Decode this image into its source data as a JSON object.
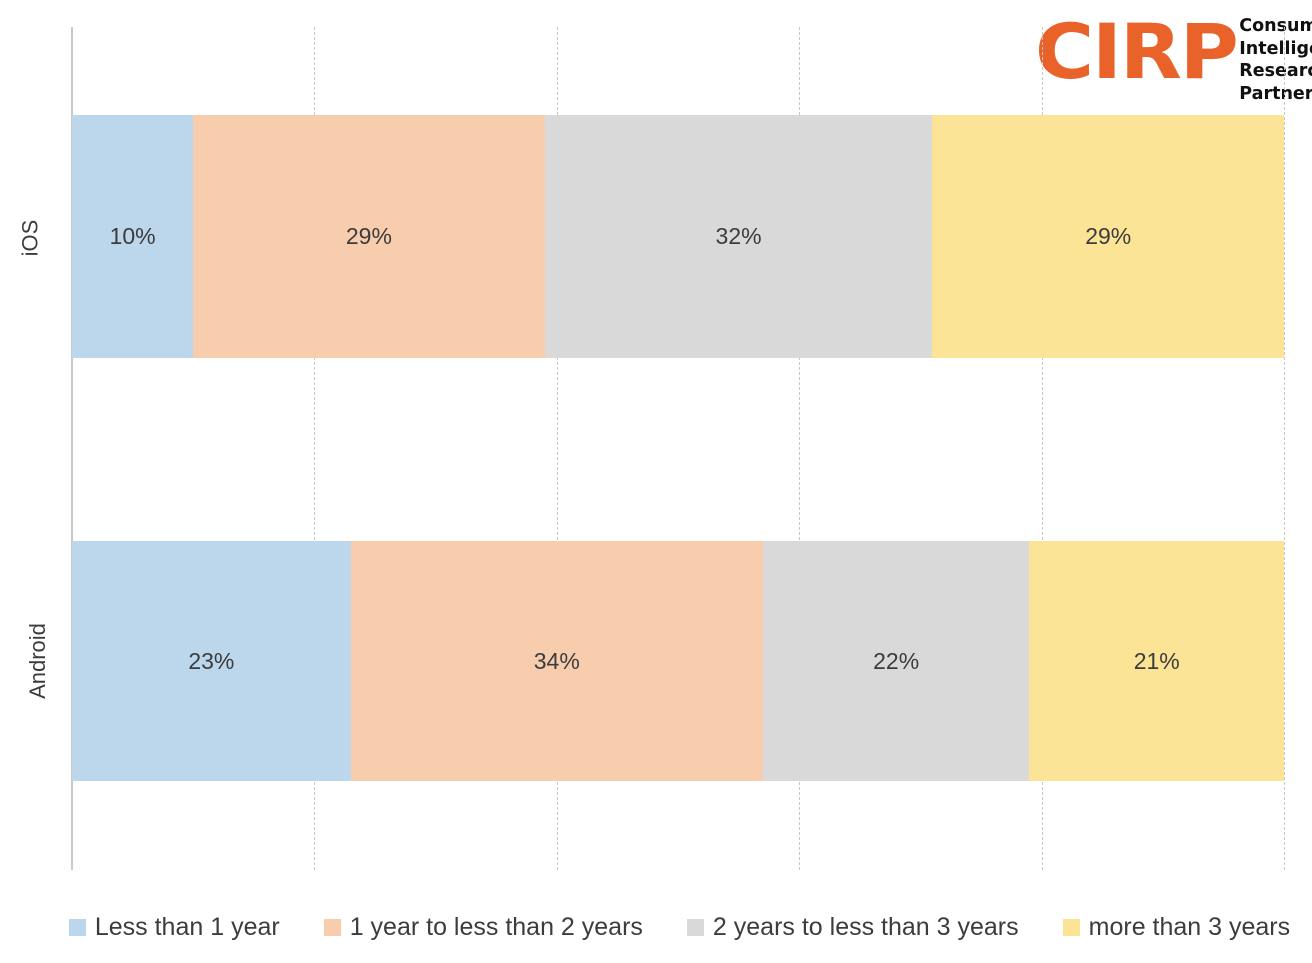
{
  "logo": {
    "mark": "CIRP",
    "line1": "Consumer",
    "line2": "Intelligence",
    "line3": "Research",
    "line4": "Partners, LLC",
    "mark_color": "#e8622a",
    "text_color": "#111111"
  },
  "chart_data": {
    "type": "bar",
    "orientation": "horizontal",
    "stacked": true,
    "normalized_percent": true,
    "title": "",
    "subtitle": "",
    "xlabel": "",
    "ylabel": "",
    "xlim": [
      0,
      100
    ],
    "grid": true,
    "gridlines_percent": [
      20,
      40,
      60,
      80,
      100
    ],
    "legend_position": "bottom",
    "categories": [
      "iOS",
      "Android"
    ],
    "series": [
      {
        "name": "Less than 1 year",
        "color": "#bcd7ec",
        "values": [
          10,
          23
        ],
        "labels": [
          "10%",
          "23%"
        ]
      },
      {
        "name": "1 year to less than 2 years",
        "color": "#f7cdae",
        "values": [
          29,
          34
        ],
        "labels": [
          "29%",
          "34%"
        ]
      },
      {
        "name": "2 years to less than 3 years",
        "color": "#d9d9d9",
        "values": [
          32,
          22
        ],
        "labels": [
          "32%",
          "22%"
        ]
      },
      {
        "name": "more than 3 years",
        "color": "#fce497",
        "values": [
          29,
          21
        ],
        "labels": [
          "29%",
          "21%"
        ]
      }
    ]
  }
}
